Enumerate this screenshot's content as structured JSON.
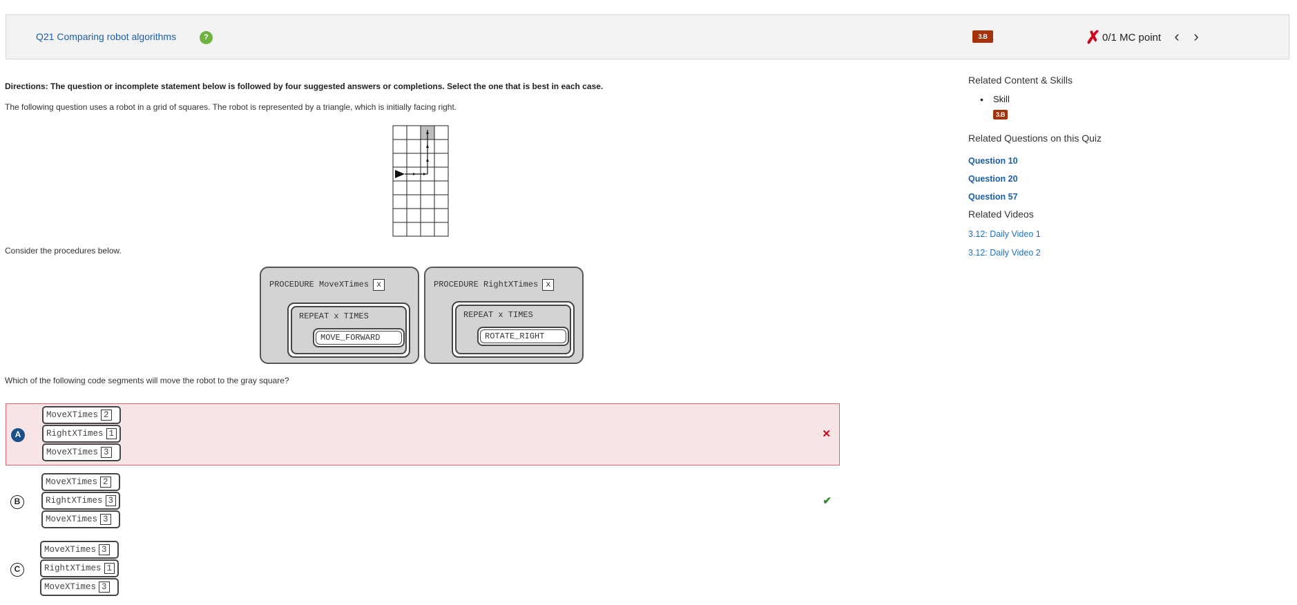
{
  "header": {
    "question_title": "Q21 Comparing robot algorithms",
    "help_icon": "question-mark-icon",
    "skill_badge": "3.B",
    "score_icon": "red-x-icon",
    "score_text": "0/1 MC point",
    "prev_icon": "chevron-left-icon",
    "next_icon": "chevron-right-icon"
  },
  "question": {
    "directions": "Directions: The question or incomplete statement below is followed by four suggested answers or completions. Select the one that is best in each case.",
    "intro": "The following question uses a robot in a grid of squares. The robot is represented by a triangle, which is initially facing right.",
    "consider": "Consider the procedures below.",
    "prompt": "Which of the following code segments will move the robot to the gray square?"
  },
  "procedures": [
    {
      "header": "PROCEDURE MoveXTimes",
      "param": "x",
      "repeat": "REPEAT x TIMES",
      "command": "MOVE_FORWARD"
    },
    {
      "header": "PROCEDURE RightXTimes",
      "param": "x",
      "repeat": "REPEAT x TIMES",
      "command": "ROTATE_RIGHT"
    }
  ],
  "choices": [
    {
      "letter": "A",
      "state": "selected-wrong",
      "mark": "✕",
      "lines": [
        {
          "name": "MoveXTimes",
          "arg": "2"
        },
        {
          "name": "RightXTimes",
          "arg": "1"
        },
        {
          "name": "MoveXTimes",
          "arg": "3"
        }
      ]
    },
    {
      "letter": "B",
      "state": "correct",
      "mark": "✔",
      "lines": [
        {
          "name": "MoveXTimes",
          "arg": "2"
        },
        {
          "name": "RightXTimes",
          "arg": "3"
        },
        {
          "name": "MoveXTimes",
          "arg": "3"
        }
      ]
    },
    {
      "letter": "C",
      "state": "none",
      "mark": "",
      "lines": [
        {
          "name": "MoveXTimes",
          "arg": "3"
        },
        {
          "name": "RightXTimes",
          "arg": "1"
        },
        {
          "name": "MoveXTimes",
          "arg": "3"
        }
      ]
    }
  ],
  "sidebar": {
    "related_content_heading": "Related Content & Skills",
    "skill_label": "Skill",
    "skill_badge": "3.B",
    "related_questions_heading": "Related Questions on this Quiz",
    "related_questions": [
      "Question 10",
      "Question 20",
      "Question 57"
    ],
    "related_videos_heading": "Related Videos",
    "related_videos": [
      "3.12: Daily Video 1",
      "3.12: Daily Video 2"
    ]
  },
  "colors": {
    "accent_link": "#1b5fa8",
    "badge": "#a4330b",
    "wrong": "#d0021b",
    "correct": "#2e8b2e",
    "selected": "#1b4f8a"
  }
}
